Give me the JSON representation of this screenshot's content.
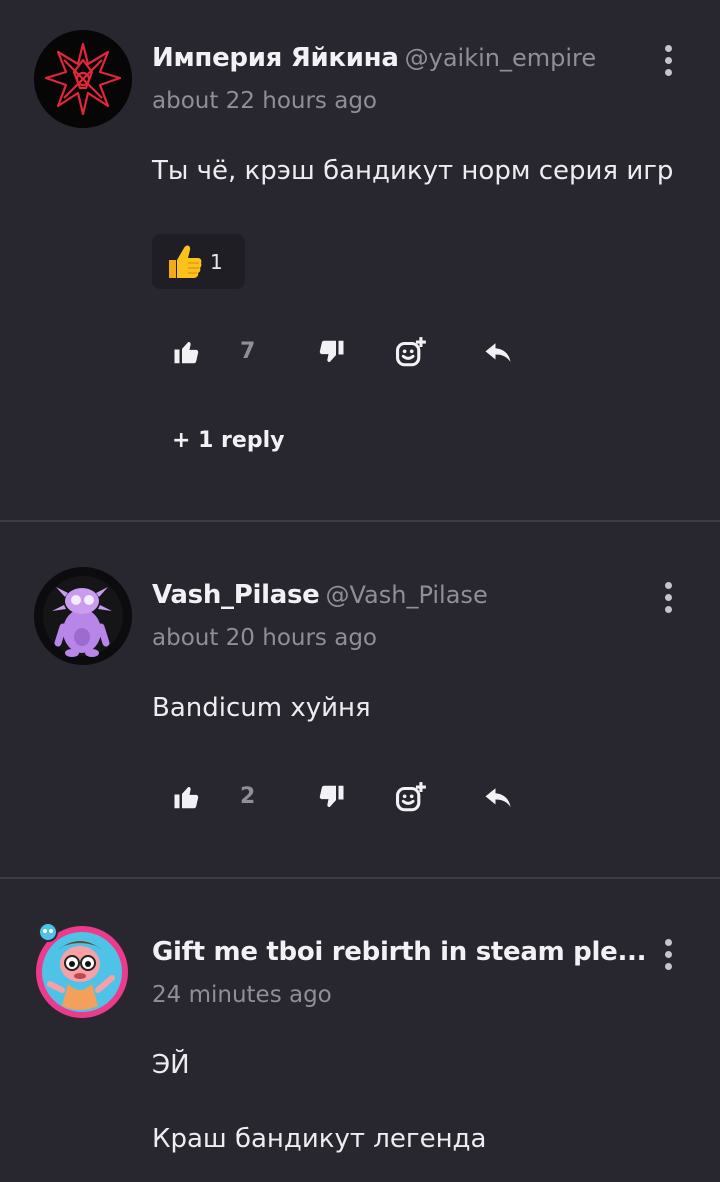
{
  "comments": [
    {
      "author": "Империя Яйкина",
      "handle": "@yaikin_empire",
      "time": "about 22 hours ago",
      "text": "Ты чё, крэш бандикут норм серия игр",
      "reaction": {
        "emoji": "thumbs-up",
        "count": "1"
      },
      "likes": "7",
      "replies_label": "+ 1 reply"
    },
    {
      "author": "Vash_Pilase",
      "handle": "@Vash_Pilase",
      "time": "about 20 hours ago",
      "text": "Bandicum хуйня",
      "likes": "2"
    },
    {
      "author": "Gift me tboi rebirth in steam ple...",
      "time": "24 minutes ago",
      "text_line1": "ЭЙ",
      "text_line2": "Краш бандикут легенда"
    }
  ],
  "icons": {
    "like": "thumbs-up-icon",
    "dislike": "thumbs-down-icon",
    "react": "add-reaction-icon",
    "reply": "reply-icon",
    "more": "more-vertical-icon"
  },
  "colors": {
    "background": "#28272f",
    "divider": "#3d3c45",
    "muted": "#8f8e99"
  }
}
